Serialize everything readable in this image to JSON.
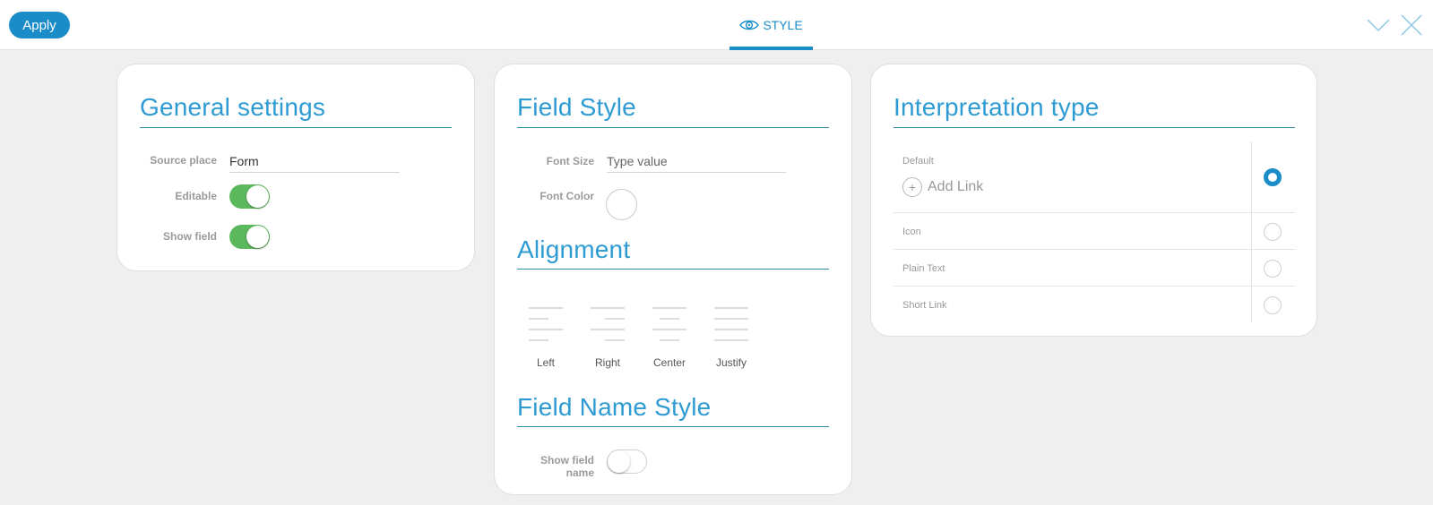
{
  "toolbar": {
    "apply_label": "Apply",
    "tab_label": "STYLE"
  },
  "icons": {
    "tab": "eye-icon",
    "collapse": "chevron-down-icon",
    "close": "close-icon"
  },
  "colors": {
    "accent": "#1a8cc8",
    "toggle_on": "#5cb85c",
    "section_line": "#2d8fa7"
  },
  "general": {
    "title": "General settings",
    "source_place_label": "Source place",
    "source_place_value": "Form",
    "editable_label": "Editable",
    "editable_on": true,
    "show_field_label": "Show field",
    "show_field_on": true
  },
  "field_style": {
    "title": "Field Style",
    "font_size_label": "Font Size",
    "font_size_placeholder": "Type value",
    "font_color_label": "Font Color",
    "alignment_title": "Alignment",
    "alignment_options": [
      "Left",
      "Right",
      "Center",
      "Justify"
    ],
    "field_name_title": "Field Name Style",
    "show_field_name_label_1": "Show field",
    "show_field_name_label_2": "name",
    "show_field_name_on": false
  },
  "interpretation": {
    "title": "Interpretation type",
    "options": [
      {
        "label": "Default",
        "selected": true
      },
      {
        "label": "Icon",
        "selected": false
      },
      {
        "label": "Plain Text",
        "selected": false
      },
      {
        "label": "Short Link",
        "selected": false
      }
    ],
    "add_link_label": "Add Link"
  }
}
